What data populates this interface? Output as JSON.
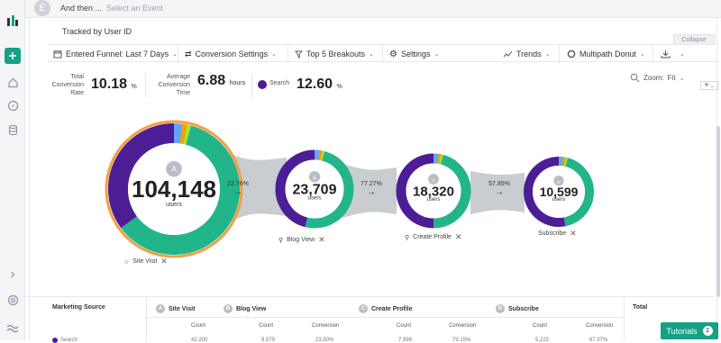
{
  "colors": {
    "accent_green": "#16a085",
    "purple": "#4c1d95",
    "teal": "#22b58a",
    "orange": "#f59e42"
  },
  "sidebar": {
    "icons": [
      "logo-icon",
      "plus-icon",
      "home-icon",
      "compass-icon",
      "database-icon",
      "chevron-right-icon",
      "help-icon",
      "brand-icon"
    ]
  },
  "topbar": {
    "avatar_letter": "E",
    "and_then": "And then ...",
    "select_event": "Select an Event"
  },
  "header": {
    "tracked": "Tracked by User ID",
    "collapse": "Collapse"
  },
  "toolbar": {
    "funnel": "Entered Funnel: Last 7 Days",
    "conversion": "Conversion Settings",
    "breakouts": "Top 5 Breakouts",
    "settings": "Settings",
    "trends": "Trends",
    "view": "Multipath Donut"
  },
  "metrics": {
    "total_label_1": "Total",
    "total_label_2": "Conversion",
    "total_label_3": "Rate",
    "total_value": "10.18",
    "total_unit": "%",
    "avg_label_1": "Average",
    "avg_label_2": "Conversion",
    "avg_label_3": "Time",
    "avg_value": "6.88",
    "avg_unit": "hours",
    "search_label": "Search",
    "search_value": "12.60",
    "search_unit": "%"
  },
  "zoom": {
    "label": "Zoom:",
    "value": "Fit"
  },
  "funnel": {
    "steps": [
      {
        "letter": "A",
        "value": "104,148",
        "unit": "users",
        "label": "Site Visit",
        "teal_frac": 0.63
      },
      {
        "letter": "B",
        "value": "23,709",
        "unit": "users",
        "label": "Blog View",
        "teal_frac": 0.52
      },
      {
        "letter": "C",
        "value": "18,320",
        "unit": "users",
        "label": "Create Profile",
        "teal_frac": 0.48
      },
      {
        "letter": "D",
        "value": "10,599",
        "unit": "users",
        "label": "Subscribe",
        "teal_frac": 0.45
      }
    ],
    "conversions": [
      "22.76%",
      "77.27%",
      "57.85%"
    ]
  },
  "table": {
    "headers": [
      "Marketing Source",
      "Site Visit",
      "Blog View",
      "Create Profile",
      "Subscribe",
      "Total"
    ],
    "letters": [
      "A",
      "B",
      "C",
      "D"
    ],
    "sub": {
      "count": "Count",
      "conversion": "Conversion"
    },
    "row_label": "Search",
    "row_values": [
      "42,200",
      "9,979",
      "23.50%",
      "7,999",
      "79.15%",
      "5,222",
      "67.57%"
    ]
  },
  "tutorials": {
    "label": "Tutorials",
    "count": "2"
  }
}
